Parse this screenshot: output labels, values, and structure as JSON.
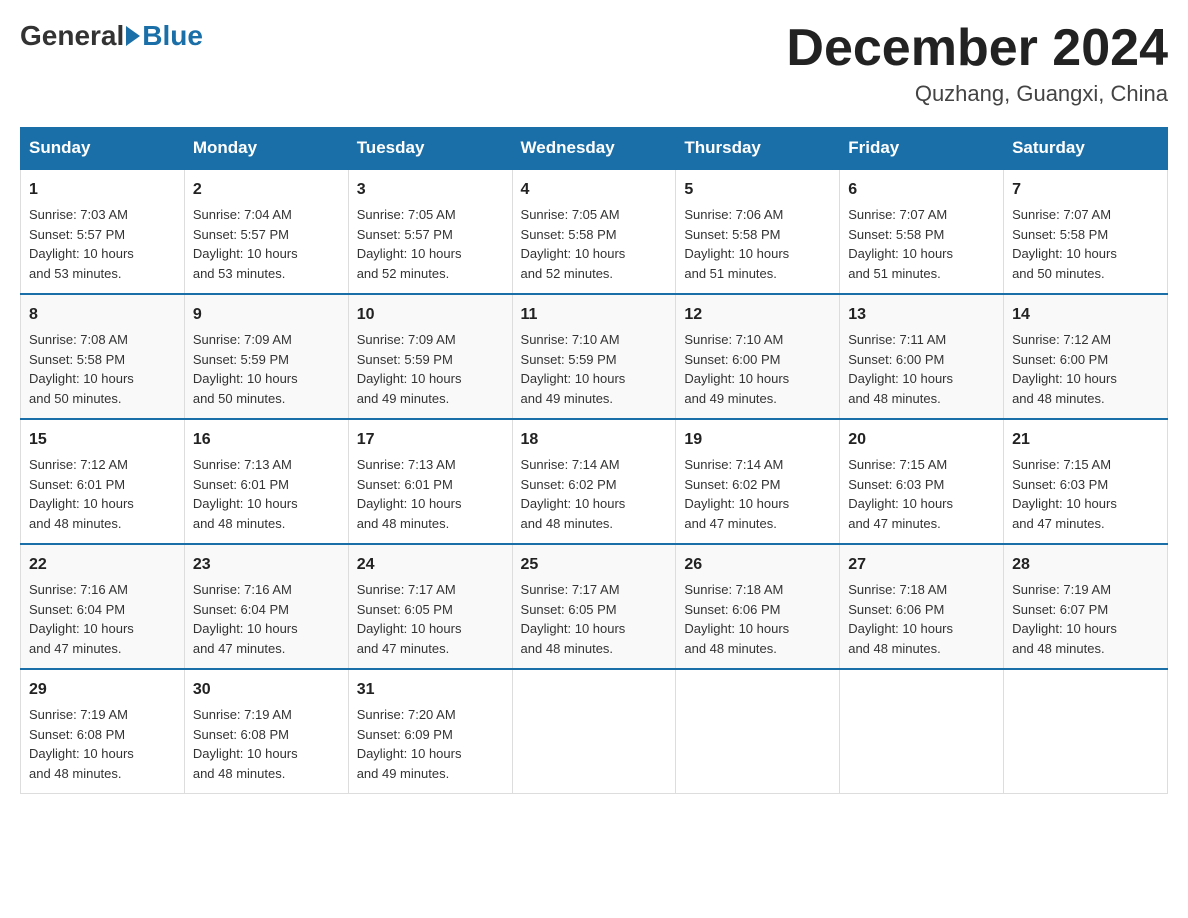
{
  "header": {
    "logo_general": "General",
    "logo_blue": "Blue",
    "month_title": "December 2024",
    "location": "Quzhang, Guangxi, China"
  },
  "days_of_week": [
    "Sunday",
    "Monday",
    "Tuesday",
    "Wednesday",
    "Thursday",
    "Friday",
    "Saturday"
  ],
  "weeks": [
    [
      {
        "day": "1",
        "sunrise": "7:03 AM",
        "sunset": "5:57 PM",
        "daylight": "10 hours and 53 minutes."
      },
      {
        "day": "2",
        "sunrise": "7:04 AM",
        "sunset": "5:57 PM",
        "daylight": "10 hours and 53 minutes."
      },
      {
        "day": "3",
        "sunrise": "7:05 AM",
        "sunset": "5:57 PM",
        "daylight": "10 hours and 52 minutes."
      },
      {
        "day": "4",
        "sunrise": "7:05 AM",
        "sunset": "5:58 PM",
        "daylight": "10 hours and 52 minutes."
      },
      {
        "day": "5",
        "sunrise": "7:06 AM",
        "sunset": "5:58 PM",
        "daylight": "10 hours and 51 minutes."
      },
      {
        "day": "6",
        "sunrise": "7:07 AM",
        "sunset": "5:58 PM",
        "daylight": "10 hours and 51 minutes."
      },
      {
        "day": "7",
        "sunrise": "7:07 AM",
        "sunset": "5:58 PM",
        "daylight": "10 hours and 50 minutes."
      }
    ],
    [
      {
        "day": "8",
        "sunrise": "7:08 AM",
        "sunset": "5:58 PM",
        "daylight": "10 hours and 50 minutes."
      },
      {
        "day": "9",
        "sunrise": "7:09 AM",
        "sunset": "5:59 PM",
        "daylight": "10 hours and 50 minutes."
      },
      {
        "day": "10",
        "sunrise": "7:09 AM",
        "sunset": "5:59 PM",
        "daylight": "10 hours and 49 minutes."
      },
      {
        "day": "11",
        "sunrise": "7:10 AM",
        "sunset": "5:59 PM",
        "daylight": "10 hours and 49 minutes."
      },
      {
        "day": "12",
        "sunrise": "7:10 AM",
        "sunset": "6:00 PM",
        "daylight": "10 hours and 49 minutes."
      },
      {
        "day": "13",
        "sunrise": "7:11 AM",
        "sunset": "6:00 PM",
        "daylight": "10 hours and 48 minutes."
      },
      {
        "day": "14",
        "sunrise": "7:12 AM",
        "sunset": "6:00 PM",
        "daylight": "10 hours and 48 minutes."
      }
    ],
    [
      {
        "day": "15",
        "sunrise": "7:12 AM",
        "sunset": "6:01 PM",
        "daylight": "10 hours and 48 minutes."
      },
      {
        "day": "16",
        "sunrise": "7:13 AM",
        "sunset": "6:01 PM",
        "daylight": "10 hours and 48 minutes."
      },
      {
        "day": "17",
        "sunrise": "7:13 AM",
        "sunset": "6:01 PM",
        "daylight": "10 hours and 48 minutes."
      },
      {
        "day": "18",
        "sunrise": "7:14 AM",
        "sunset": "6:02 PM",
        "daylight": "10 hours and 48 minutes."
      },
      {
        "day": "19",
        "sunrise": "7:14 AM",
        "sunset": "6:02 PM",
        "daylight": "10 hours and 47 minutes."
      },
      {
        "day": "20",
        "sunrise": "7:15 AM",
        "sunset": "6:03 PM",
        "daylight": "10 hours and 47 minutes."
      },
      {
        "day": "21",
        "sunrise": "7:15 AM",
        "sunset": "6:03 PM",
        "daylight": "10 hours and 47 minutes."
      }
    ],
    [
      {
        "day": "22",
        "sunrise": "7:16 AM",
        "sunset": "6:04 PM",
        "daylight": "10 hours and 47 minutes."
      },
      {
        "day": "23",
        "sunrise": "7:16 AM",
        "sunset": "6:04 PM",
        "daylight": "10 hours and 47 minutes."
      },
      {
        "day": "24",
        "sunrise": "7:17 AM",
        "sunset": "6:05 PM",
        "daylight": "10 hours and 47 minutes."
      },
      {
        "day": "25",
        "sunrise": "7:17 AM",
        "sunset": "6:05 PM",
        "daylight": "10 hours and 48 minutes."
      },
      {
        "day": "26",
        "sunrise": "7:18 AM",
        "sunset": "6:06 PM",
        "daylight": "10 hours and 48 minutes."
      },
      {
        "day": "27",
        "sunrise": "7:18 AM",
        "sunset": "6:06 PM",
        "daylight": "10 hours and 48 minutes."
      },
      {
        "day": "28",
        "sunrise": "7:19 AM",
        "sunset": "6:07 PM",
        "daylight": "10 hours and 48 minutes."
      }
    ],
    [
      {
        "day": "29",
        "sunrise": "7:19 AM",
        "sunset": "6:08 PM",
        "daylight": "10 hours and 48 minutes."
      },
      {
        "day": "30",
        "sunrise": "7:19 AM",
        "sunset": "6:08 PM",
        "daylight": "10 hours and 48 minutes."
      },
      {
        "day": "31",
        "sunrise": "7:20 AM",
        "sunset": "6:09 PM",
        "daylight": "10 hours and 49 minutes."
      },
      null,
      null,
      null,
      null
    ]
  ],
  "labels": {
    "sunrise": "Sunrise:",
    "sunset": "Sunset:",
    "daylight": "Daylight:"
  }
}
